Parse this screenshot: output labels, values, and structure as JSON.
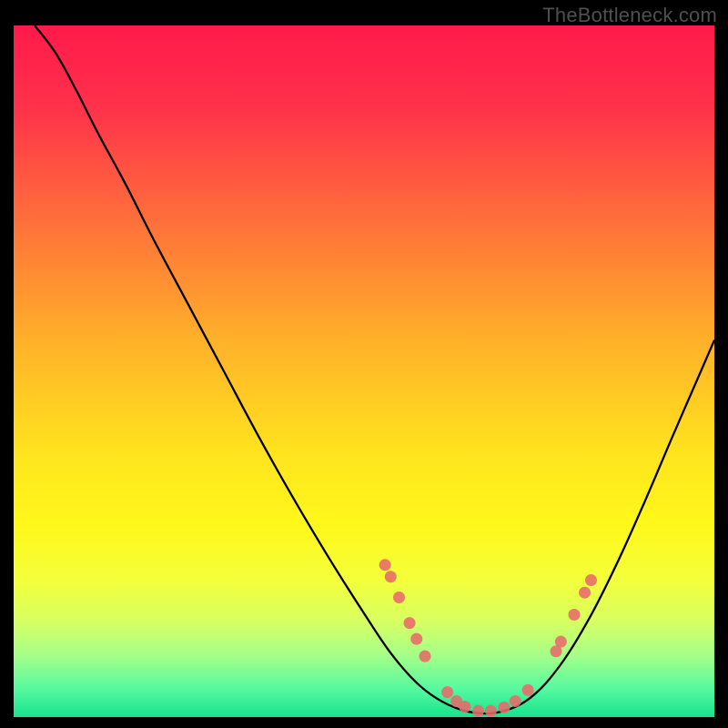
{
  "watermark": "TheBottleneck.com",
  "chart_data": {
    "type": "line",
    "title": "",
    "xlabel": "",
    "ylabel": "",
    "xlim": [
      0,
      100
    ],
    "ylim": [
      0,
      100
    ],
    "background_gradient": {
      "stops": [
        {
          "offset": 0.0,
          "color": "#ff1a4b"
        },
        {
          "offset": 0.12,
          "color": "#ff324a"
        },
        {
          "offset": 0.28,
          "color": "#ff6e3a"
        },
        {
          "offset": 0.45,
          "color": "#ffaf2a"
        },
        {
          "offset": 0.62,
          "color": "#ffe41e"
        },
        {
          "offset": 0.72,
          "color": "#fff81a"
        },
        {
          "offset": 0.8,
          "color": "#f4ff3a"
        },
        {
          "offset": 0.86,
          "color": "#d9ff60"
        },
        {
          "offset": 0.91,
          "color": "#a6ff87"
        },
        {
          "offset": 0.96,
          "color": "#55f9a0"
        },
        {
          "offset": 1.0,
          "color": "#17e38c"
        }
      ]
    },
    "series": [
      {
        "name": "bottleneck-curve",
        "type": "line",
        "color": "#000000",
        "points": [
          {
            "x": 3.0,
            "y": 100.0
          },
          {
            "x": 6.0,
            "y": 96.0
          },
          {
            "x": 9.0,
            "y": 90.5
          },
          {
            "x": 12.0,
            "y": 84.5
          },
          {
            "x": 16.0,
            "y": 77.0
          },
          {
            "x": 20.0,
            "y": 69.0
          },
          {
            "x": 25.0,
            "y": 59.5
          },
          {
            "x": 30.0,
            "y": 50.0
          },
          {
            "x": 35.0,
            "y": 40.5
          },
          {
            "x": 40.0,
            "y": 31.5
          },
          {
            "x": 45.0,
            "y": 23.0
          },
          {
            "x": 50.0,
            "y": 15.0
          },
          {
            "x": 54.0,
            "y": 9.0
          },
          {
            "x": 58.0,
            "y": 4.5
          },
          {
            "x": 62.0,
            "y": 1.8
          },
          {
            "x": 66.0,
            "y": 0.6
          },
          {
            "x": 70.0,
            "y": 0.9
          },
          {
            "x": 74.0,
            "y": 3.0
          },
          {
            "x": 78.0,
            "y": 7.5
          },
          {
            "x": 82.0,
            "y": 14.0
          },
          {
            "x": 86.0,
            "y": 22.0
          },
          {
            "x": 90.0,
            "y": 31.0
          },
          {
            "x": 94.0,
            "y": 40.5
          },
          {
            "x": 97.0,
            "y": 47.5
          },
          {
            "x": 100.0,
            "y": 54.5
          }
        ]
      },
      {
        "name": "sample-dots",
        "type": "scatter",
        "color": "#e86a6a",
        "points": [
          {
            "x": 53.0,
            "y": 22.0
          },
          {
            "x": 53.8,
            "y": 20.3
          },
          {
            "x": 55.0,
            "y": 17.3
          },
          {
            "x": 56.5,
            "y": 13.6
          },
          {
            "x": 57.5,
            "y": 11.3
          },
          {
            "x": 58.7,
            "y": 8.8
          },
          {
            "x": 61.9,
            "y": 3.6
          },
          {
            "x": 63.2,
            "y": 2.3
          },
          {
            "x": 64.4,
            "y": 1.5
          },
          {
            "x": 66.3,
            "y": 0.9
          },
          {
            "x": 68.1,
            "y": 0.9
          },
          {
            "x": 70.0,
            "y": 1.4
          },
          {
            "x": 71.6,
            "y": 2.3
          },
          {
            "x": 73.4,
            "y": 3.9
          },
          {
            "x": 77.4,
            "y": 9.5
          },
          {
            "x": 78.1,
            "y": 10.9
          },
          {
            "x": 80.0,
            "y": 14.8
          },
          {
            "x": 81.5,
            "y": 18.0
          },
          {
            "x": 82.4,
            "y": 19.8
          }
        ]
      }
    ],
    "annotations": []
  }
}
